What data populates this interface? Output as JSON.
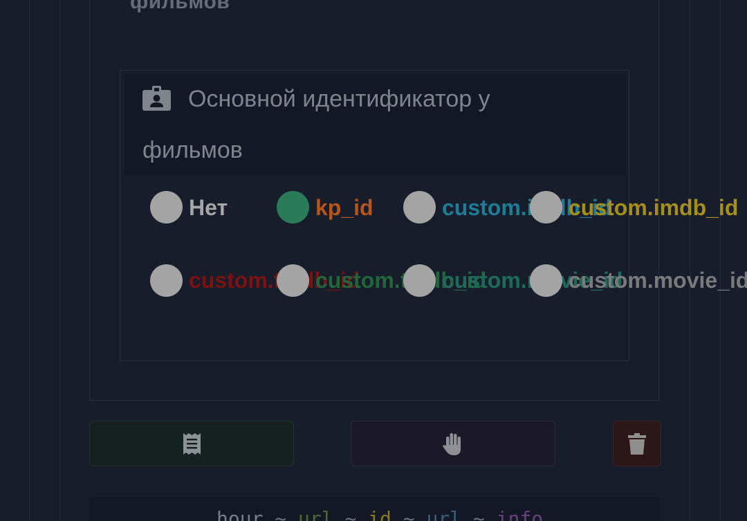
{
  "previous_section": {
    "title_fragment": "фильмов"
  },
  "field": {
    "icon": "id-badge-icon",
    "title_line1": "Основной идентификатор у",
    "title_line2": "фильмов",
    "options": [
      {
        "label": "Нет",
        "checked": false,
        "color": "#a6a6a6"
      },
      {
        "label": "kp_id",
        "checked": true,
        "color": "#b8561a"
      },
      {
        "label": "custom.imdb_id",
        "checked": false,
        "color": "#1f7c96"
      },
      {
        "label": "custom.imdb_id",
        "checked": false,
        "color": "#a58e1c"
      },
      {
        "label": "custom.tmdb_id",
        "checked": false,
        "color": "#7d1212"
      },
      {
        "label": "custom.tmdb_id",
        "checked": false,
        "color": "#23653a"
      },
      {
        "label": "custom.movie_id",
        "checked": false,
        "color": "#1d6a5a"
      },
      {
        "label": "custom.movie_id",
        "checked": false,
        "color": "#7a7a7a"
      }
    ]
  },
  "actions": {
    "save_icon": "receipt-icon",
    "hand_icon": "hand-icon",
    "delete_icon": "trash-icon",
    "colors": {
      "save": "#15211f",
      "hand": "#1b1827",
      "delete": "#2b1718"
    }
  },
  "code": {
    "tokens": [
      {
        "text": "hour",
        "color": "#7a7e86"
      },
      {
        "text": " ~ ",
        "color": "#6b7079"
      },
      {
        "text": "url",
        "color": "#4d6a2e"
      },
      {
        "text": " ~ ",
        "color": "#6b7079"
      },
      {
        "text": "id",
        "color": "#8a7a1e"
      },
      {
        "text": " ~ ",
        "color": "#6b7079"
      },
      {
        "text": "url",
        "color": "#3c5f78"
      },
      {
        "text": " ~ ",
        "color": "#6b7079"
      },
      {
        "text": "info",
        "color": "#6a3f80"
      }
    ]
  }
}
